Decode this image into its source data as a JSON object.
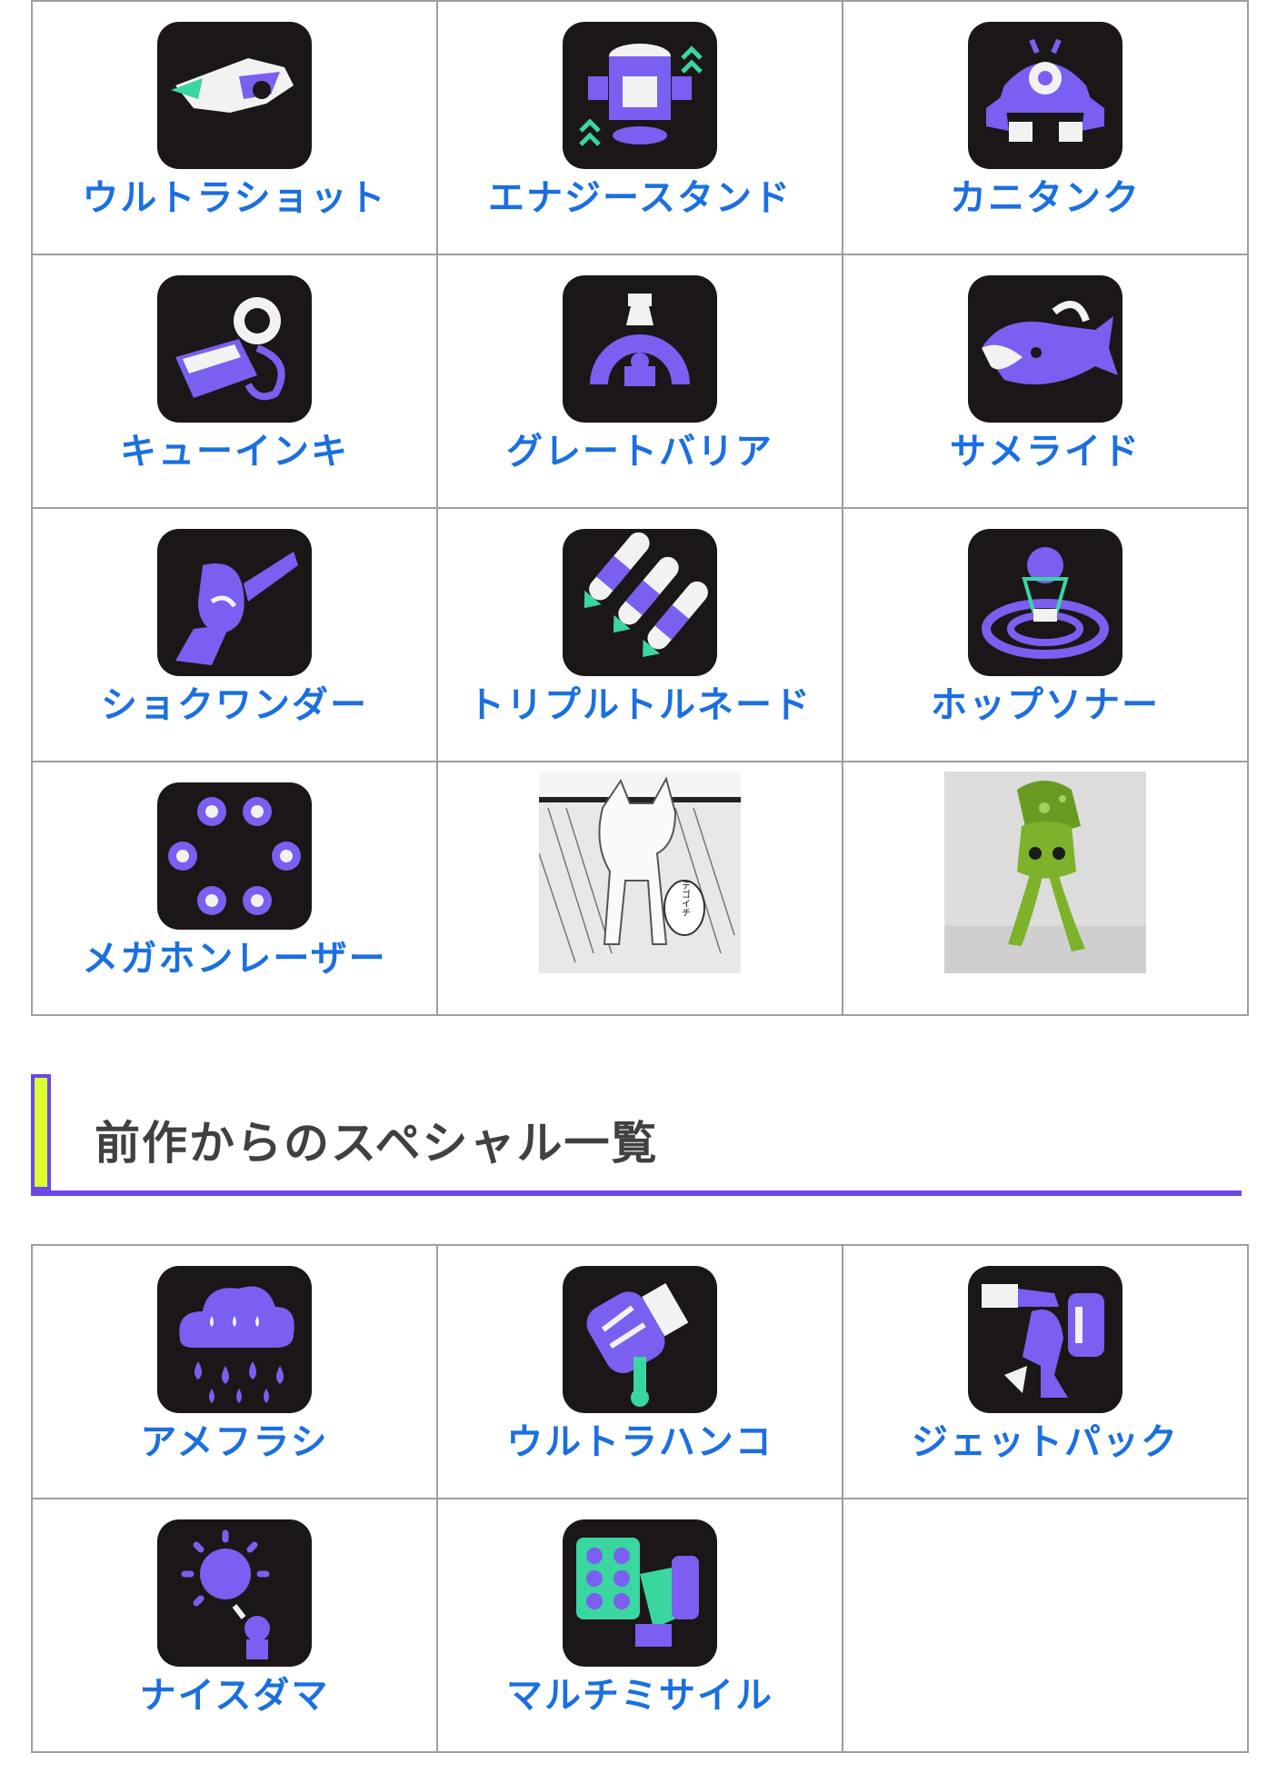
{
  "current_specials": [
    {
      "name": "ウルトラショット",
      "icon": "ultra-shot-icon"
    },
    {
      "name": "エナジースタンド",
      "icon": "energy-stand-icon"
    },
    {
      "name": "カニタンク",
      "icon": "crab-tank-icon"
    },
    {
      "name": "キューインキ",
      "icon": "ink-vac-icon"
    },
    {
      "name": "グレートバリア",
      "icon": "big-bubbler-icon"
    },
    {
      "name": "サメライド",
      "icon": "reefslider-icon"
    },
    {
      "name": "ショクワンダー",
      "icon": "zipcaster-icon"
    },
    {
      "name": "トリプルトルネード",
      "icon": "triple-inkstrike-icon"
    },
    {
      "name": "ホップソナー",
      "icon": "wave-breaker-icon"
    },
    {
      "name": "メガホンレーザー",
      "icon": "killer-wail-icon"
    }
  ],
  "extra_images": [
    {
      "caption": "デゴイチ",
      "icon": "manga-dog-photo"
    },
    {
      "caption": "",
      "icon": "green-squid-figure-photo"
    }
  ],
  "section_heading": "前作からのスペシャル一覧",
  "previous_specials": [
    {
      "name": "アメフラシ",
      "icon": "ink-storm-icon"
    },
    {
      "name": "ウルトラハンコ",
      "icon": "ultra-stamp-icon"
    },
    {
      "name": "ジェットパック",
      "icon": "inkjet-icon"
    },
    {
      "name": "ナイスダマ",
      "icon": "booyah-bomb-icon"
    },
    {
      "name": "マルチミサイル",
      "icon": "tenta-missiles-icon"
    }
  ],
  "colors": {
    "label": "#1b6fe0",
    "icon_bg": "#1b1718",
    "accent_purple": "#6a48e8",
    "accent_lime": "#dcff32",
    "border": "#9e9e9e"
  }
}
